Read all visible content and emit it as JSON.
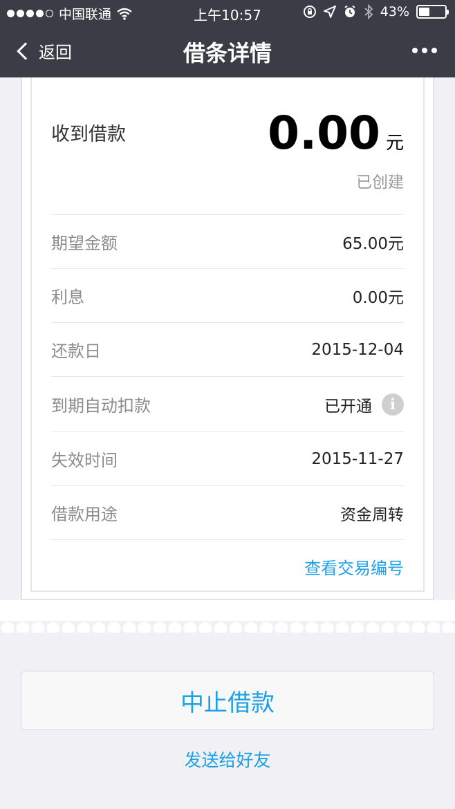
{
  "status_bar": {
    "carrier": "中国联通",
    "time": "上午10:57",
    "battery": "43%",
    "battery_level": 0.43
  },
  "nav": {
    "back_label": "返回",
    "title": "借条详情"
  },
  "receipt": {
    "label": "收到借款",
    "amount": "0.00",
    "unit": "元",
    "status": "已创建",
    "rows": [
      {
        "key": "期望金额",
        "value": "65.00元"
      },
      {
        "key": "利息",
        "value": "0.00元"
      },
      {
        "key": "还款日",
        "value": "2015-12-04"
      },
      {
        "key": "到期自动扣款",
        "value": "已开通"
      },
      {
        "key": "失效时间",
        "value": "2015-11-27"
      },
      {
        "key": "借款用途",
        "value": "资金周转"
      }
    ],
    "view_txn_link": "查看交易编号"
  },
  "actions": {
    "stop_button": "中止借款",
    "send_link": "发送给好友"
  },
  "colors": {
    "accent": "#1ea0e6",
    "header_bg": "#3a3d45",
    "page_bg": "#f1f1f5"
  },
  "icons": {
    "wifi": "wifi-icon",
    "lock": "rotation-lock-icon",
    "location": "location-arrow-icon",
    "alarm": "alarm-icon",
    "bluetooth": "bluetooth-icon",
    "info": "info-icon"
  }
}
